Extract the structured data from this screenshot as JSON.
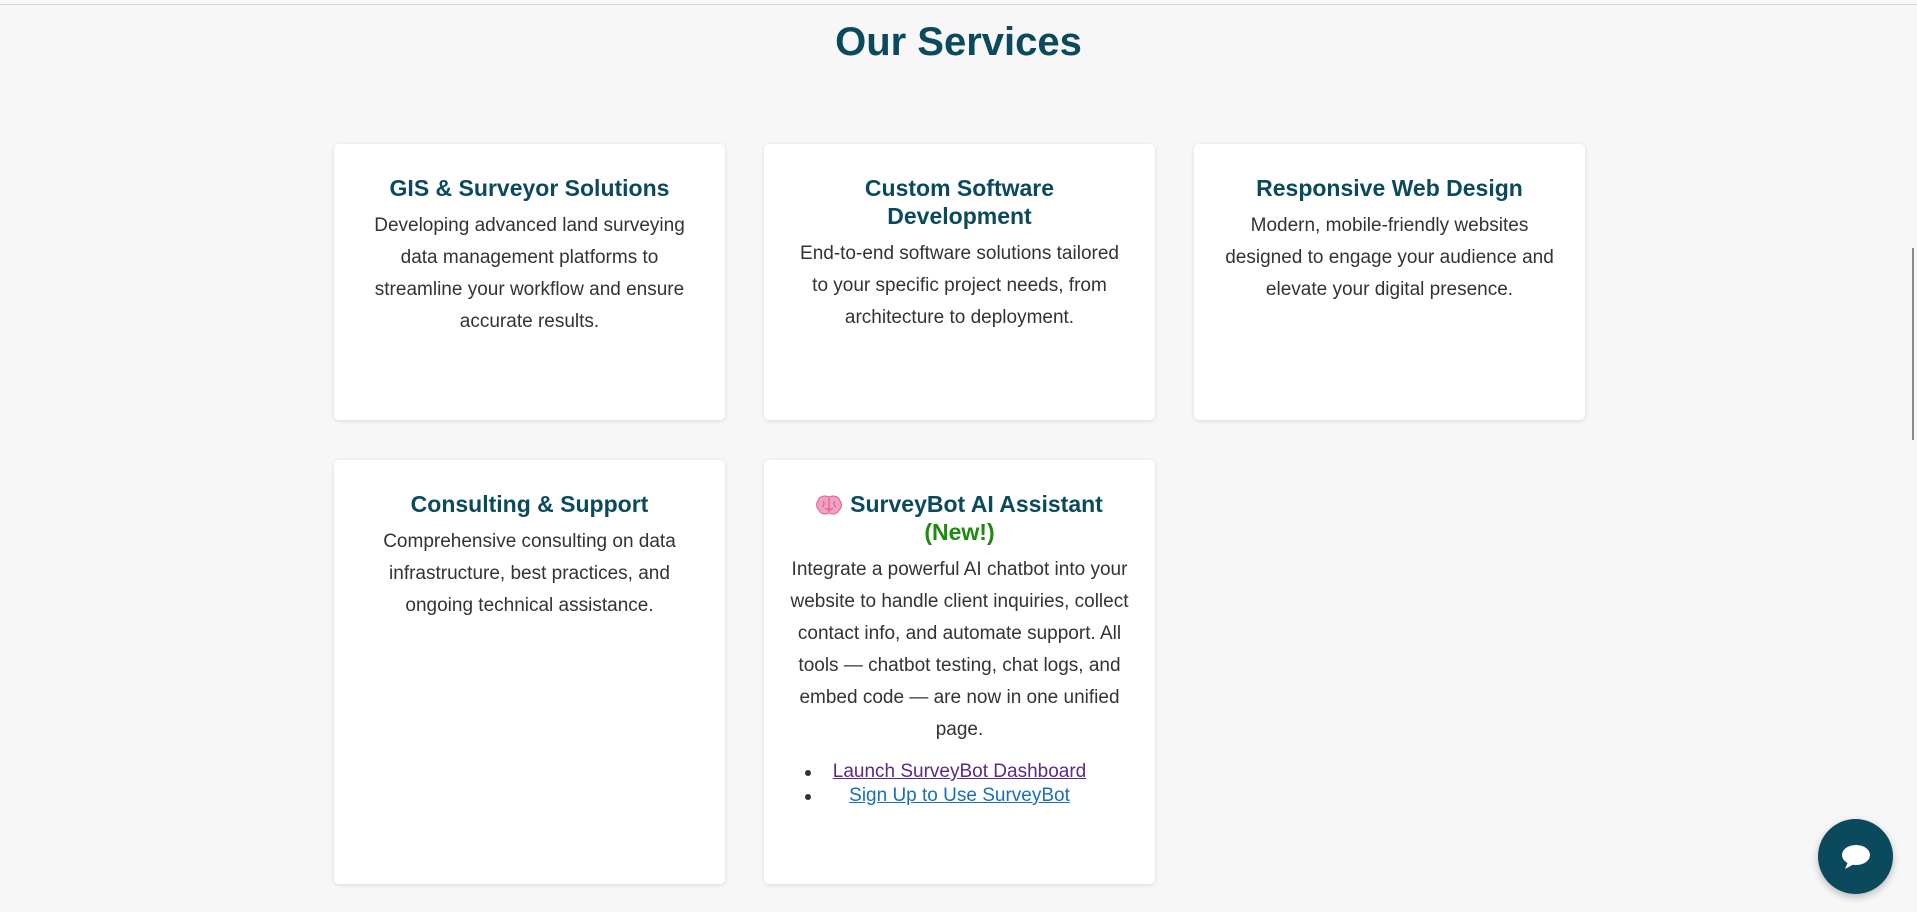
{
  "section": {
    "title": "Our Services"
  },
  "cards": [
    {
      "title": "GIS & Surveyor Solutions",
      "description": "Developing advanced land surveying data management platforms to streamline your workflow and ensure accurate results."
    },
    {
      "title": "Custom Software Development",
      "description": "End-to-end software solutions tailored to your specific project needs, from architecture to deployment."
    },
    {
      "title": "Responsive Web Design",
      "description": "Modern, mobile-friendly websites designed to engage your audience and elevate your digital presence."
    },
    {
      "title": "Consulting & Support",
      "description": "Comprehensive consulting on data infrastructure, best practices, and ongoing technical assistance."
    },
    {
      "icon": "brain-icon",
      "title": "SurveyBot AI Assistant",
      "badge": "(New!)",
      "description": "Integrate a powerful AI chatbot into your website to handle client inquiries, collect contact info, and automate support. All tools — chatbot testing, chat logs, and embed code — are now in one unified page.",
      "links": [
        "Launch SurveyBot Dashboard",
        "Sign Up to Use SurveyBot"
      ]
    }
  ],
  "chat_widget": {
    "icon": "chat-bubble-icon"
  },
  "colors": {
    "heading": "#0b4a5c",
    "body_text": "#333333",
    "badge_new": "#1e8a10",
    "link_visited": "#5b2a86",
    "link": "#1a6fb3",
    "page_background": "#f7f7f7",
    "card_background": "#ffffff",
    "chat_button": "#0b4a5c"
  }
}
